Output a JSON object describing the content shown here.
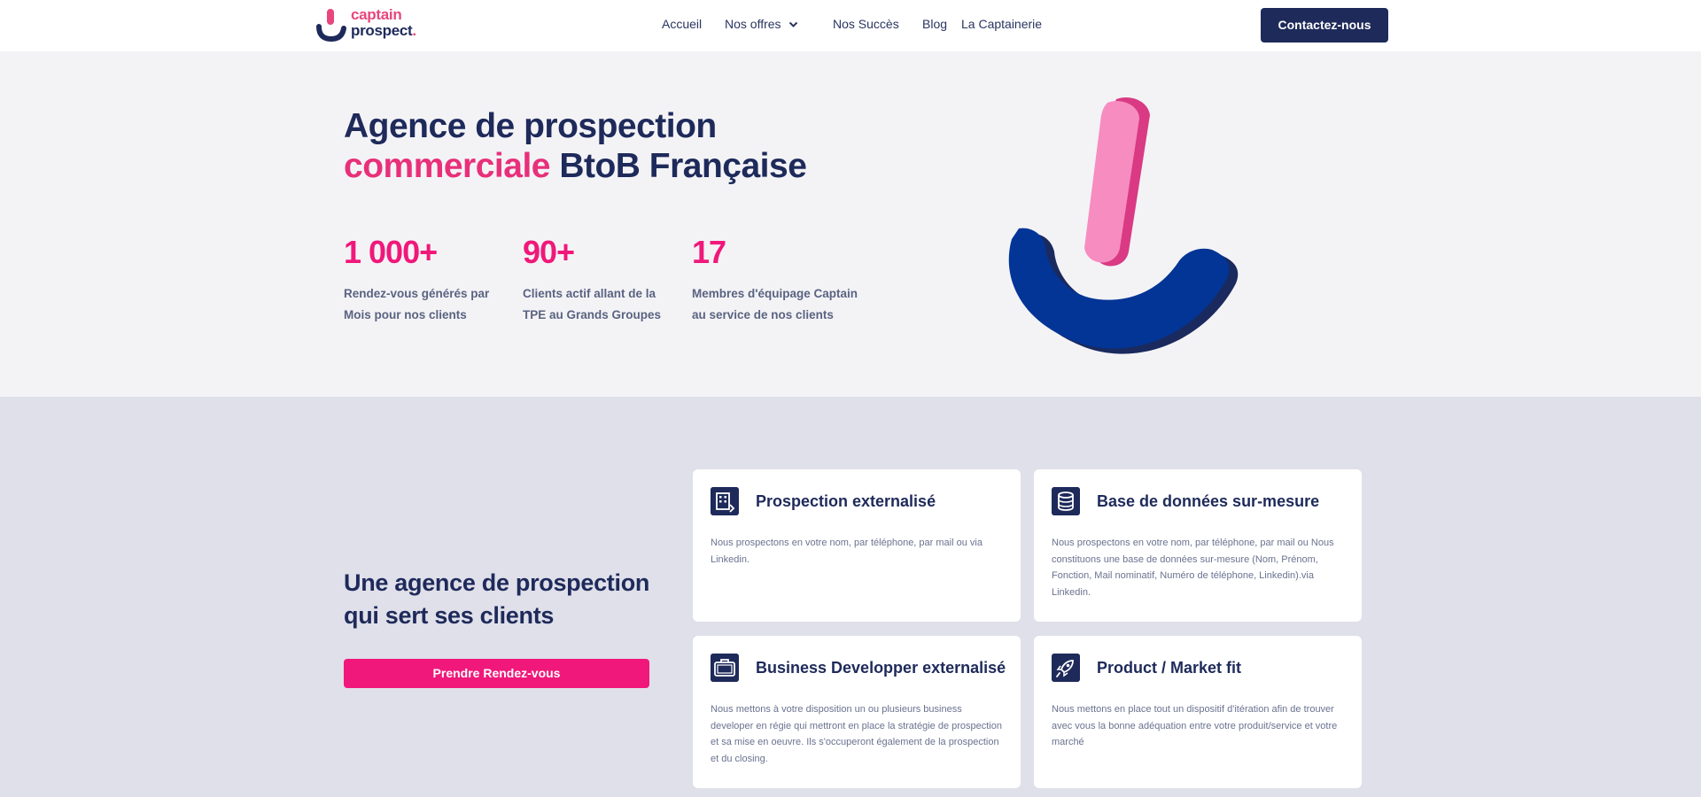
{
  "brand": {
    "line1": "captain",
    "line2": "prospect",
    "dot": "."
  },
  "nav": {
    "items": [
      "Accueil",
      "Nos offres",
      "Nos Succès",
      "Blog",
      "La Captainerie"
    ],
    "contact_label": "Contactez-nous"
  },
  "hero": {
    "title_line1": "Agence de prospection",
    "title_accent": "commerciale",
    "title_rest": " BtoB Française",
    "stats": [
      {
        "value": "1 000+",
        "label_l1": "Rendez-vous générés par",
        "label_l2": "Mois pour nos clients"
      },
      {
        "value": "90+",
        "label_l1": "Clients actif allant de la",
        "label_l2": "TPE au Grands Groupes"
      },
      {
        "value": "17",
        "label_l1": "Membres d'équipage Captain",
        "label_l2": "au service de nos clients"
      }
    ]
  },
  "services": {
    "title_l1": "Une agence de prospection",
    "title_l2": "qui sert ses clients",
    "cta_label": "Prendre Rendez-vous",
    "cards": [
      {
        "icon": "building-icon",
        "title": "Prospection externalisé",
        "desc": "Nous prospectons en votre nom, par téléphone, par mail ou via Linkedin."
      },
      {
        "icon": "database-icon",
        "title": "Base de données sur-mesure",
        "desc": "Nous prospectons en votre nom, par téléphone, par mail ou Nous constituons une base de données sur-mesure (Nom, Prénom, Fonction, Mail nominatif, Numéro de téléphone, Linkedin).via Linkedin."
      },
      {
        "icon": "briefcase-icon",
        "title": "Business Developper externalisé",
        "desc": "Nous mettons à votre disposition un ou plusieurs business developer en régie qui mettront en place la stratégie de prospection et sa mise en oeuvre. Ils s'occuperont également de la prospection et du closing."
      },
      {
        "icon": "rocket-icon",
        "title": "Product / Market fit",
        "desc": "Nous mettons en place tout un dispositif d'itération afin de trouver avec vous la bonne adéquation entre votre produit/service et votre marché"
      }
    ]
  },
  "colors": {
    "navy": "#1e2a5a",
    "pink": "#f0187a",
    "hero_bg": "#f3f3f6",
    "section_bg": "#e0e0ea"
  }
}
